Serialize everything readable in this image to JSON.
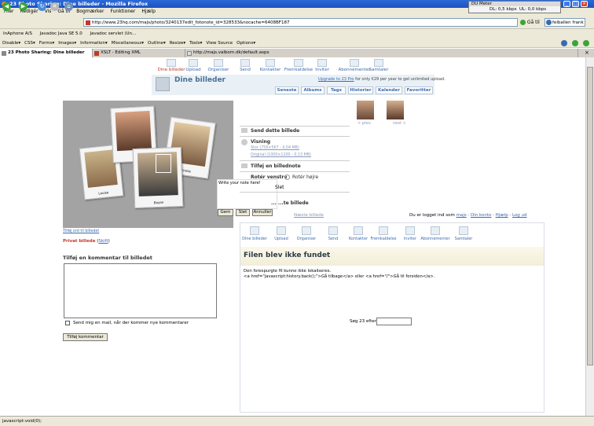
{
  "window": {
    "title": "23 Photo Sharing: Dine billeder - Mozilla Firefox"
  },
  "du_meter": {
    "title": "DU Meter",
    "dl": "DL: 0,5 kbps",
    "ul": "UL: 0,0 kbps"
  },
  "menubar": [
    "Filer",
    "Redigér",
    "Vis",
    "Gå til",
    "Bogmærker",
    "Funktioner",
    "Hjælp"
  ],
  "address": {
    "url": "http://www.23hq.com/majs/photo/3240137edit_fotonote_id=328533&nocache=6408BF187",
    "go_label": "Gå til",
    "search_value": "felballen frank"
  },
  "bookmarks": [
    "InAphone A/S",
    "Javadoc Java SE 5.0",
    "Javadoc servlet (Un..."
  ],
  "webdev_toolbar": [
    "Disable▾",
    "CSS▾",
    "Forms▾",
    "Images▾",
    "Information▾",
    "Miscellaneous▾",
    "Outline▾",
    "Resize▾",
    "Tools▾",
    "View Source",
    "Options▾"
  ],
  "tabs": [
    {
      "label": "23 Photo Sharing: Dine billeder",
      "active": true
    },
    {
      "label": "XSLT - Editing XML",
      "active": false
    },
    {
      "label": "http://majs.valborn.dk/default.aspx",
      "active": false
    }
  ],
  "site_nav": [
    "Dine billeder",
    "Upload",
    "Organiser",
    "Send",
    "Kontakter",
    "Fremkaldelse",
    "Inviter",
    "Abonnementer",
    "Samtaler"
  ],
  "header": {
    "title": "Dine billeder",
    "upgrade_link": "Upgrade to 23 Pro",
    "upgrade_text": "for only €29 per year to get unlimited upload."
  },
  "subtabs": [
    "Seneste",
    "Albums",
    "Tags",
    "Historier",
    "Kalender",
    "Favoritter"
  ],
  "photo": {
    "captions": [
      "Louise",
      "Emilie",
      "Bayan"
    ],
    "note_text": "Write your note here!",
    "note_buttons": [
      "Gem",
      "Slet",
      "Annuller"
    ],
    "add_note_link": "Tilføj ord til billedet"
  },
  "private": {
    "label": "Privat billede",
    "change": "Skift"
  },
  "thumbs": {
    "prev": "< prev",
    "next": "next >"
  },
  "side": {
    "send": "Send dette billede",
    "visning": "Visning",
    "size_stor": "Stor (756×567 - 0,04 MB)",
    "size_original": "Original (1000×1200 - 0,13 MB)",
    "add_note": "Tilføj en billednote",
    "rotate_left": "Rotér venstre",
    "rotate_right": "Rotér højre",
    "slet": "Slet",
    "partial": "... ...te billede",
    "links": "Næste billede"
  },
  "comment": {
    "heading": "Tilføj en kommentar til billedet",
    "email_label": "Send mig en mail, når der kommer nye kommentarer",
    "submit": "Tilføj kommentar"
  },
  "inner": {
    "logged_in": "Du er logget ind som",
    "user": "majs",
    "account": "Din konto",
    "help": "Hjælp",
    "logout": "Log ud",
    "nav": [
      "Dine billeder",
      "Upload",
      "Organiser",
      "Send",
      "Kontakter",
      "Fremkaldelse",
      "Inviter",
      "Abonnementer",
      "Samtaler"
    ],
    "title": "Filen blev ikke fundet",
    "message_line1": "Den forespurgte fil kunne ikke lokaliseres.",
    "message_line2": "<a href=\"javascript:history.back();\">Gå tilbage</a> eller <a href=\"/\">Gå til forsiden</a>.",
    "search_label": "Søg 23 efter:"
  },
  "status": "javascript:void(0);"
}
